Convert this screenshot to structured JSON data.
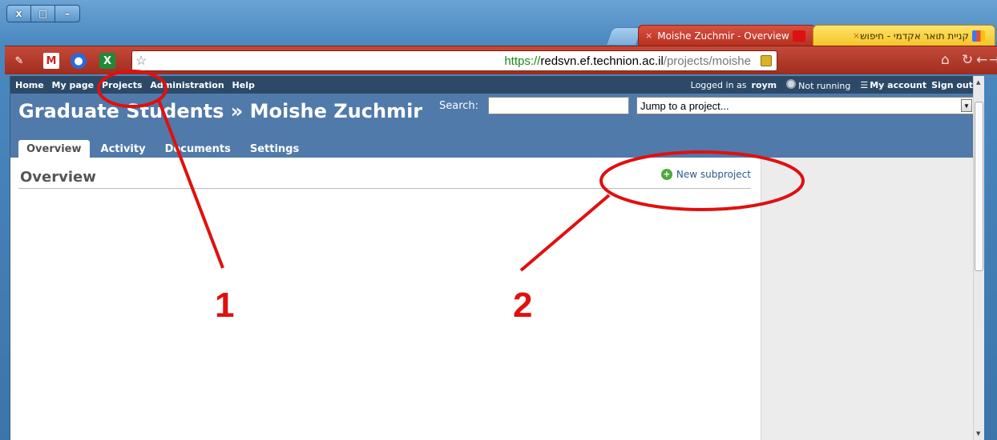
{
  "window": {
    "buttons": [
      "x",
      "□",
      "–"
    ]
  },
  "tabs": [
    {
      "title": "Moishe Zuchmir - Overview",
      "active": true
    },
    {
      "title": "קניית תואר אקדמי - חיפוש",
      "active": false
    }
  ],
  "address": {
    "scheme": "https://",
    "host": "redsvn.ef.technion.ac.il",
    "path": "/projects/moishe"
  },
  "topmenu": {
    "items": [
      "Home",
      "My page",
      "Projects",
      "Administration",
      "Help"
    ],
    "logged_prefix": "Logged in as",
    "user": "roym",
    "status": "Not running",
    "my_account": "My account",
    "sign_out": "Sign out"
  },
  "header": {
    "title": "Graduate Students » Moishe Zuchmir",
    "search_label": "Search:",
    "jump_placeholder": "Jump to a project..."
  },
  "project_tabs": [
    "Overview",
    "Activity",
    "Documents",
    "Settings"
  ],
  "main": {
    "heading": "Overview",
    "new_subproject": "New subproject"
  },
  "annotations": {
    "label_1": "1",
    "label_2": "2"
  },
  "colors": {
    "header_bg": "#507aaa",
    "topmenu_bg": "#2c4a68",
    "annotation": "#e01010"
  }
}
